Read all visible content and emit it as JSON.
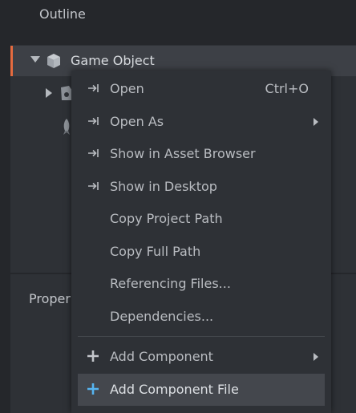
{
  "outline": {
    "title": "Outline",
    "root_item": {
      "label": "Game Object",
      "icon": "cube-icon"
    },
    "children": [
      {
        "icon": "component-file-icon"
      },
      {
        "icon": "rocket-icon"
      }
    ]
  },
  "properties": {
    "title": "Proper"
  },
  "context_menu": {
    "items": [
      {
        "label": "Open",
        "shortcut": "Ctrl+O",
        "icon": "open-arrow-icon"
      },
      {
        "label": "Open As",
        "icon": "open-arrow-icon",
        "submenu": true
      },
      {
        "label": "Show in Asset Browser",
        "icon": "open-arrow-icon"
      },
      {
        "label": "Show in Desktop",
        "icon": "open-arrow-icon"
      },
      {
        "label": "Copy Project Path"
      },
      {
        "label": "Copy Full Path"
      },
      {
        "label": "Referencing Files..."
      },
      {
        "label": "Dependencies..."
      },
      {
        "label": "Add Component",
        "icon": "plus-icon",
        "submenu": true
      },
      {
        "label": "Add Component File",
        "icon": "plus-icon",
        "highlighted": true
      }
    ]
  },
  "colors": {
    "accent": "#e56b3f",
    "add_file_plus": "#56b4f0",
    "panel_bg": "#2e3136",
    "header_bg": "#25272b"
  }
}
